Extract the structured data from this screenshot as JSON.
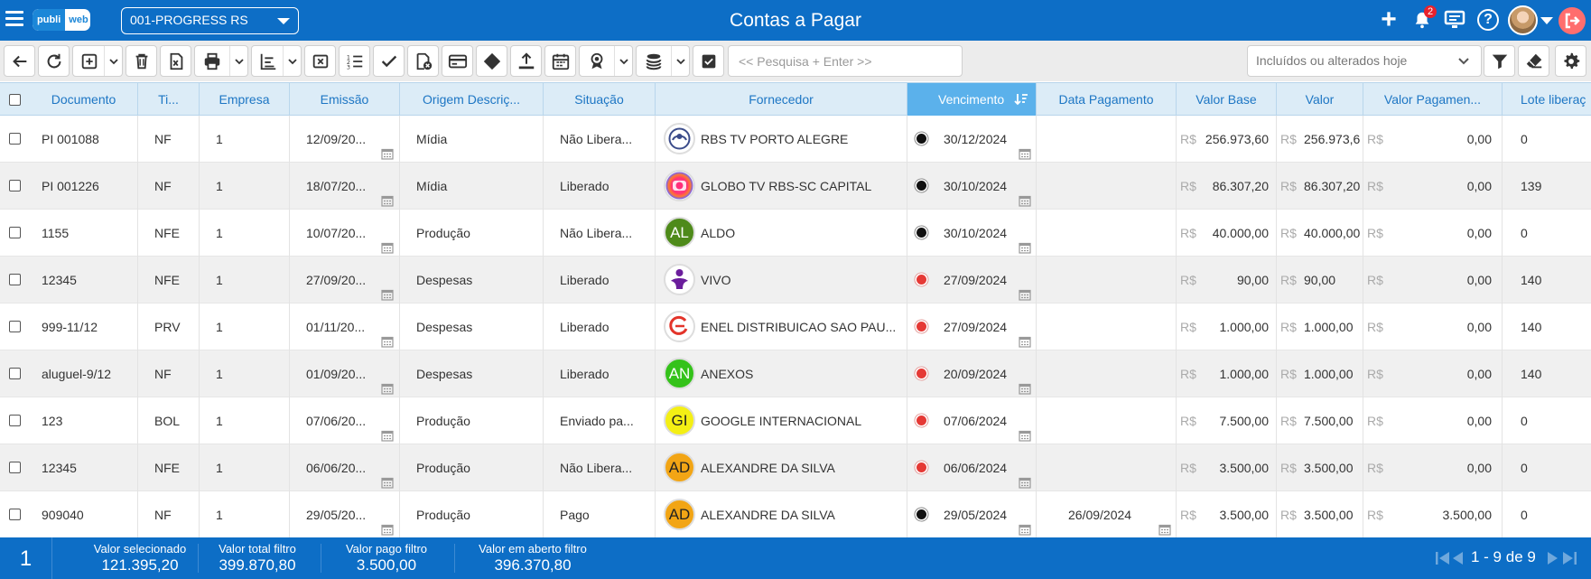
{
  "header": {
    "logo_part1": "publi",
    "logo_part2": "web",
    "company": "001-PROGRESS RS",
    "title": "Contas a Pagar",
    "notification_count": "2",
    "help_glyph": "?"
  },
  "toolbar": {
    "search_placeholder": "<< Pesquisa + Enter >>",
    "filter_value": "Incluídos ou alterados hoje"
  },
  "columns": [
    "Documento",
    "Ti...",
    "Empresa",
    "Emissão",
    "Origem Descriç...",
    "Situação",
    "Fornecedor",
    "Vencimento",
    "Data Pagamento",
    "Valor Base",
    "Valor",
    "Valor Pagamen...",
    "Lote liberaç"
  ],
  "currency_symbol": "R$",
  "rows": [
    {
      "doc": "PI 001088",
      "tipo": "NF",
      "empresa": "1",
      "emissao": "12/09/20...",
      "origem": "Mídia",
      "situacao": "Não Libera...",
      "fornecedor": "RBS TV PORTO ALEGRE",
      "avatar": "",
      "avatar_kind": "rbs",
      "status": "black",
      "vencimento": "30/12/2024",
      "pagamento": "",
      "valor_base": "256.973,60",
      "valor": "256.973,6",
      "valor_pago": "0,00",
      "lote": "0"
    },
    {
      "doc": "PI 001226",
      "tipo": "NF",
      "empresa": "1",
      "emissao": "18/07/20...",
      "origem": "Mídia",
      "situacao": "Liberado",
      "fornecedor": "GLOBO TV RBS-SC CAPITAL",
      "avatar": "",
      "avatar_kind": "globo",
      "status": "black",
      "vencimento": "30/10/2024",
      "pagamento": "",
      "valor_base": "86.307,20",
      "valor": "86.307,20",
      "valor_pago": "0,00",
      "lote": "139"
    },
    {
      "doc": "1155",
      "tipo": "NFE",
      "empresa": "1",
      "emissao": "10/07/20...",
      "origem": "Produção",
      "situacao": "Não Libera...",
      "fornecedor": "ALDO",
      "avatar": "AL",
      "avatar_kind": "initials",
      "avatar_color": "#4e8a1a",
      "avatar_text": "#ffffff",
      "status": "black",
      "vencimento": "30/10/2024",
      "pagamento": "",
      "valor_base": "40.000,00",
      "valor": "40.000,00",
      "valor_pago": "0,00",
      "lote": "0"
    },
    {
      "doc": "12345",
      "tipo": "NFE",
      "empresa": "1",
      "emissao": "27/09/20...",
      "origem": "Despesas",
      "situacao": "Liberado",
      "fornecedor": "VIVO",
      "avatar": "",
      "avatar_kind": "vivo",
      "status": "red",
      "vencimento": "27/09/2024",
      "pagamento": "",
      "valor_base": "90,00",
      "valor": "90,00",
      "valor_pago": "0,00",
      "lote": "140"
    },
    {
      "doc": "999-11/12",
      "tipo": "PRV",
      "empresa": "1",
      "emissao": "01/11/20...",
      "origem": "Despesas",
      "situacao": "Liberado",
      "fornecedor": "ENEL DISTRIBUICAO SAO PAU...",
      "avatar": "",
      "avatar_kind": "enel",
      "status": "red",
      "vencimento": "27/09/2024",
      "pagamento": "",
      "valor_base": "1.000,00",
      "valor": "1.000,00",
      "valor_pago": "0,00",
      "lote": "140"
    },
    {
      "doc": "aluguel-9/12",
      "tipo": "NF",
      "empresa": "1",
      "emissao": "01/09/20...",
      "origem": "Despesas",
      "situacao": "Liberado",
      "fornecedor": "ANEXOS",
      "avatar": "AN",
      "avatar_kind": "initials",
      "avatar_color": "#34c21a",
      "avatar_text": "#ffffff",
      "status": "red",
      "vencimento": "20/09/2024",
      "pagamento": "",
      "valor_base": "1.000,00",
      "valor": "1.000,00",
      "valor_pago": "0,00",
      "lote": "140"
    },
    {
      "doc": "123",
      "tipo": "BOL",
      "empresa": "1",
      "emissao": "07/06/20...",
      "origem": "Produção",
      "situacao": "Enviado pa...",
      "fornecedor": "GOOGLE INTERNACIONAL",
      "avatar": "GI",
      "avatar_kind": "initials",
      "avatar_color": "#f4ef14",
      "avatar_text": "#222222",
      "status": "red",
      "vencimento": "07/06/2024",
      "pagamento": "",
      "valor_base": "7.500,00",
      "valor": "7.500,00",
      "valor_pago": "0,00",
      "lote": "0"
    },
    {
      "doc": "12345",
      "tipo": "NFE",
      "empresa": "1",
      "emissao": "06/06/20...",
      "origem": "Produção",
      "situacao": "Não Libera...",
      "fornecedor": "ALEXANDRE DA SILVA",
      "avatar": "AD",
      "avatar_kind": "initials",
      "avatar_color": "#f2a515",
      "avatar_text": "#222222",
      "status": "red",
      "vencimento": "06/06/2024",
      "pagamento": "",
      "valor_base": "3.500,00",
      "valor": "3.500,00",
      "valor_pago": "0,00",
      "lote": "0"
    },
    {
      "doc": "909040",
      "tipo": "NF",
      "empresa": "1",
      "emissao": "29/05/20...",
      "origem": "Produção",
      "situacao": "Pago",
      "fornecedor": "ALEXANDRE DA SILVA",
      "avatar": "AD",
      "avatar_kind": "initials",
      "avatar_color": "#f2a515",
      "avatar_text": "#222222",
      "status": "black",
      "vencimento": "29/05/2024",
      "pagamento": "26/09/2024",
      "valor_base": "3.500,00",
      "valor": "3.500,00",
      "valor_pago": "3.500,00",
      "lote": "0"
    }
  ],
  "footer": {
    "count": "1",
    "valor_selecionado_label": "Valor selecionado",
    "valor_selecionado": "121.395,20",
    "valor_total_label": "Valor total filtro",
    "valor_total": "399.870,80",
    "valor_pago_label": "Valor pago filtro",
    "valor_pago": "3.500,00",
    "valor_aberto_label": "Valor em aberto filtro",
    "valor_aberto": "396.370,80",
    "pagination": "1 - 9 de 9"
  }
}
